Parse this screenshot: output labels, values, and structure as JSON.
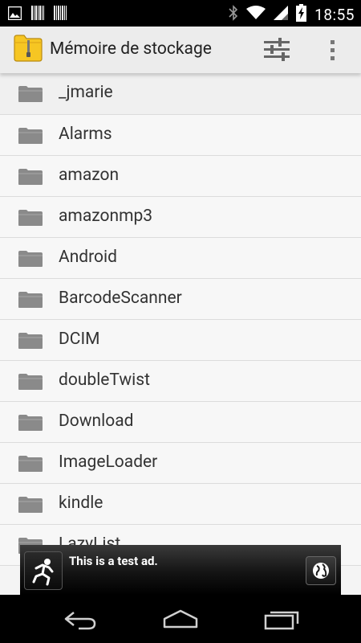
{
  "status_bar": {
    "time": "18:55",
    "icons": [
      "image-icon",
      "barcode-icon",
      "barcode-icon",
      "bluetooth-icon",
      "wifi-icon",
      "signal-icon",
      "battery-charging-icon"
    ]
  },
  "action_bar": {
    "title": "Mémoire de stockage",
    "app_icon": "folder-zip-icon",
    "actions": [
      "settings-sliders-icon",
      "overflow-menu-icon"
    ]
  },
  "folders": [
    {
      "name": "_jmarie"
    },
    {
      "name": "Alarms"
    },
    {
      "name": "amazon"
    },
    {
      "name": "amazonmp3"
    },
    {
      "name": "Android"
    },
    {
      "name": "BarcodeScanner"
    },
    {
      "name": "DCIM"
    },
    {
      "name": "doubleTwist"
    },
    {
      "name": "Download"
    },
    {
      "name": "ImageLoader"
    },
    {
      "name": "kindle"
    },
    {
      "name": "LazyList"
    }
  ],
  "ad": {
    "text": "This is a test ad.",
    "icon": "running-person-icon",
    "action_icon": "globe-icon"
  },
  "nav_bar": {
    "buttons": [
      "back-icon",
      "home-icon",
      "recents-icon"
    ]
  },
  "colors": {
    "status_bar": "#000000",
    "action_bar": "#ececec",
    "list_background": "#f7f7f7",
    "folder_icon": "#8a8a8a",
    "app_icon_yellow": "#f6c623"
  }
}
